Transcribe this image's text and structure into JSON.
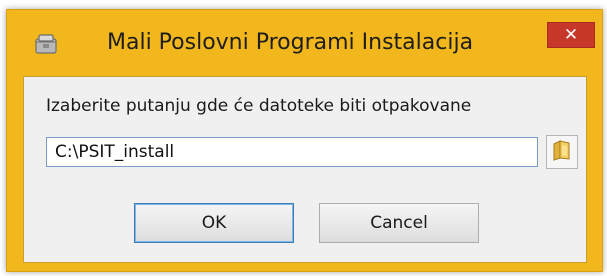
{
  "window": {
    "title": "Mali Poslovni Programi Instalacija",
    "close_label": "✕",
    "app_icon": "installer-icon",
    "accent_color": "#f2b71c",
    "close_color": "#c7372a"
  },
  "dialog": {
    "prompt": "Izaberite putanju gde će datoteke biti otpakovane",
    "path_value": "C:\\PSIT_install",
    "browse_icon": "folder-icon",
    "ok_label": "OK",
    "cancel_label": "Cancel"
  }
}
